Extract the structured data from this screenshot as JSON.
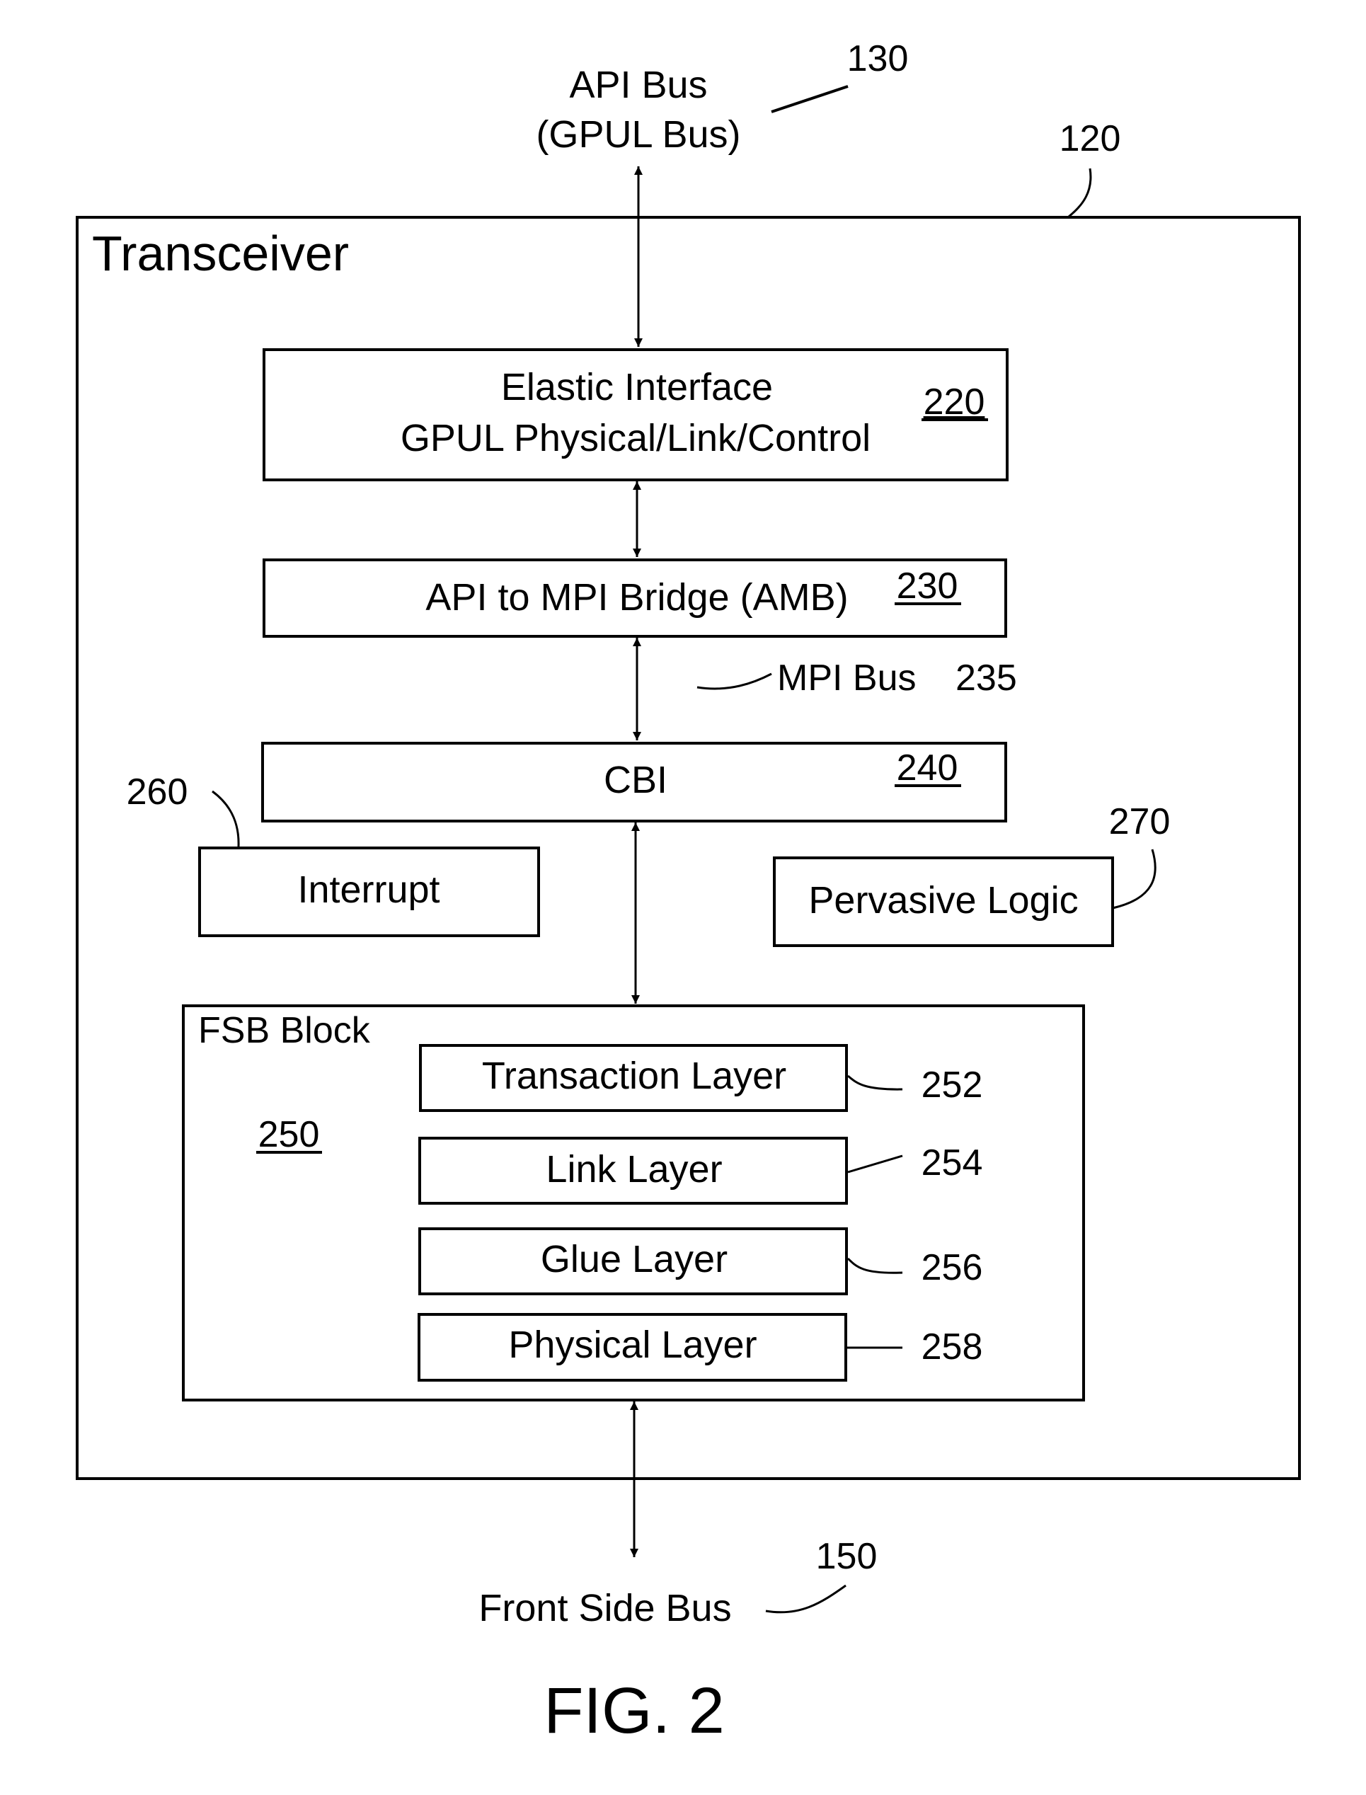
{
  "figure": {
    "caption": "FIG. 2",
    "api_bus": {
      "line1": "API Bus",
      "line2": "(GPUL Bus)",
      "ref": "130"
    },
    "transceiver": {
      "title": "Transceiver",
      "ref": "120"
    },
    "elastic_interface": {
      "line1": "Elastic Interface",
      "line2": "GPUL Physical/Link/Control",
      "ref": "220"
    },
    "amb": {
      "label": "API to MPI Bridge (AMB)",
      "ref": "230"
    },
    "mpi_bus": {
      "label": "MPI Bus",
      "ref": "235"
    },
    "cbi": {
      "label": "CBI",
      "ref": "240"
    },
    "interrupt": {
      "label": "Interrupt",
      "ref": "260"
    },
    "pervasive": {
      "label": "Pervasive Logic",
      "ref": "270"
    },
    "fsb_block": {
      "title": "FSB Block",
      "ref": "250",
      "layers": [
        {
          "label": "Transaction Layer",
          "ref": "252"
        },
        {
          "label": "Link Layer",
          "ref": "254"
        },
        {
          "label": "Glue Layer",
          "ref": "256"
        },
        {
          "label": "Physical Layer",
          "ref": "258"
        }
      ]
    },
    "front_side_bus": {
      "label": "Front Side Bus",
      "ref": "150"
    }
  }
}
